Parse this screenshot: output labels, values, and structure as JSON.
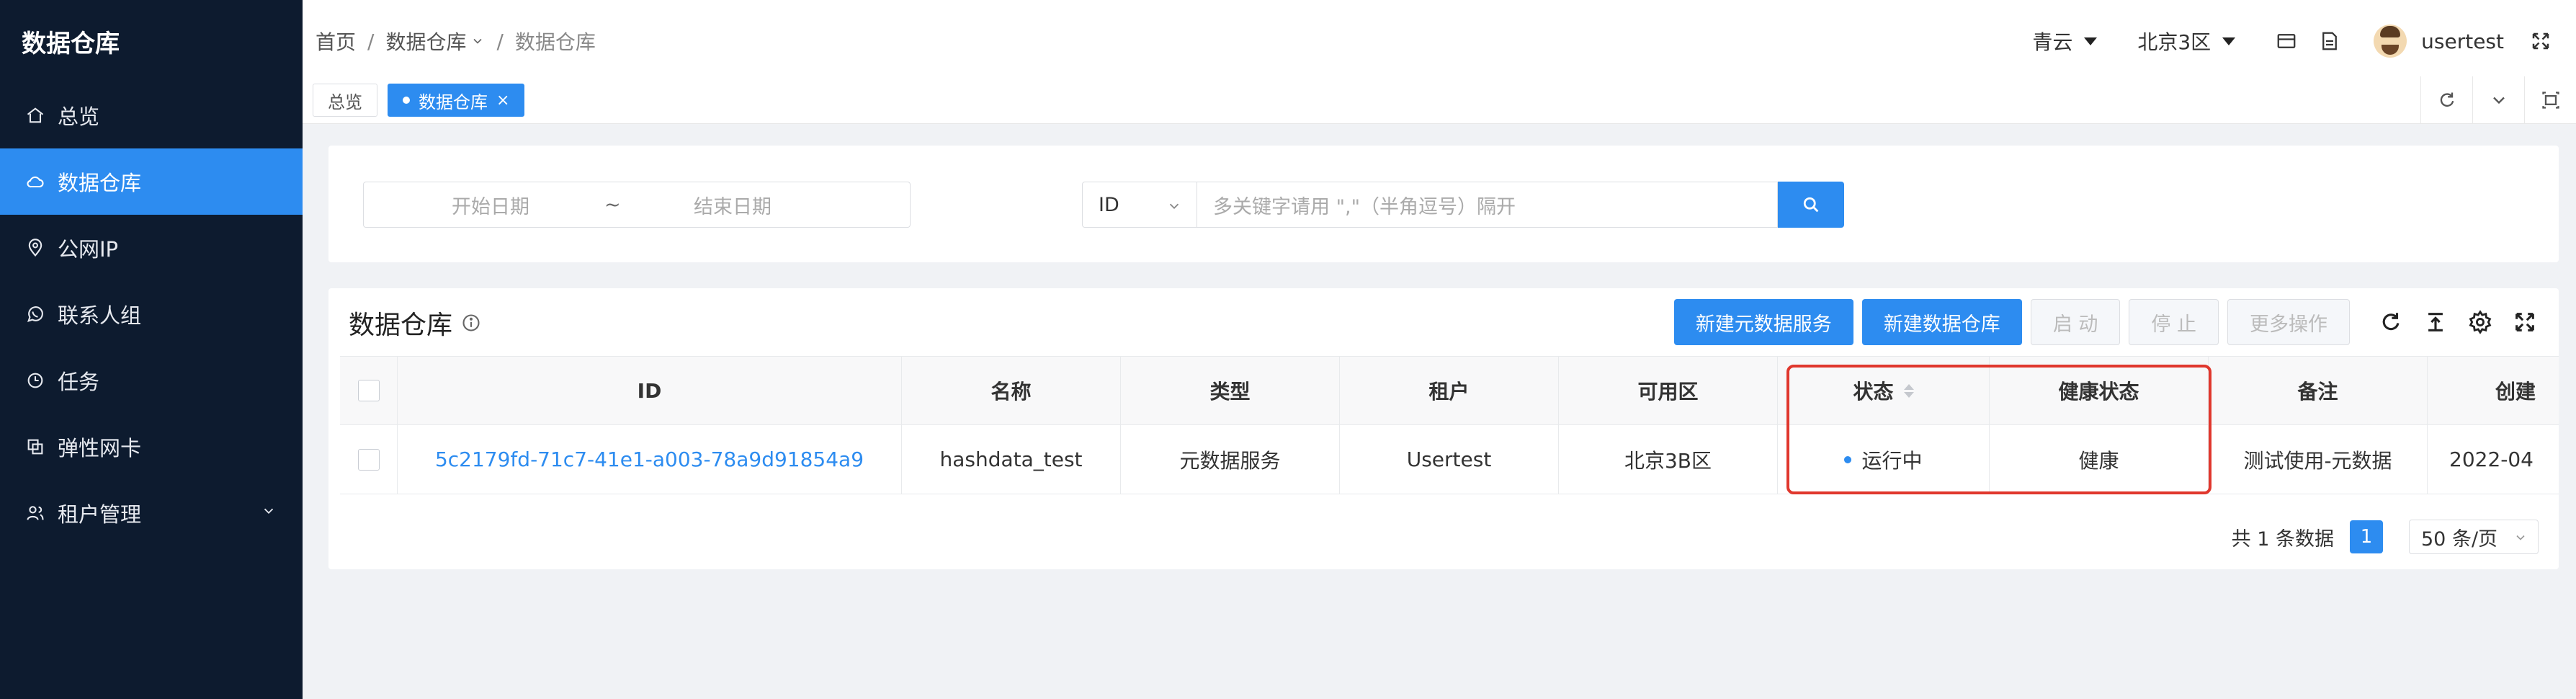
{
  "sidebar": {
    "brand": "数据仓库",
    "items": [
      {
        "label": "总览",
        "icon": "home-icon"
      },
      {
        "label": "数据仓库",
        "icon": "cloud-icon",
        "active": true
      },
      {
        "label": "公网IP",
        "icon": "location-icon"
      },
      {
        "label": "联系人组",
        "icon": "whatsapp-icon"
      },
      {
        "label": "任务",
        "icon": "clock-icon"
      },
      {
        "label": "弹性网卡",
        "icon": "copy-icon"
      },
      {
        "label": "租户管理",
        "icon": "users-icon",
        "expandable": true
      }
    ]
  },
  "header": {
    "breadcrumb": [
      "首页",
      "数据仓库",
      "数据仓库"
    ],
    "cloud": "青云",
    "zone": "北京3区",
    "username": "usertest"
  },
  "tabs": [
    {
      "label": "总览",
      "active": false
    },
    {
      "label": "数据仓库",
      "active": true
    }
  ],
  "filter": {
    "start_date": "开始日期",
    "tilde": "~",
    "end_date": "结束日期",
    "field": "ID",
    "keyword_placeholder": "多关键字请用 \",\"（半角逗号）隔开"
  },
  "main": {
    "title": "数据仓库",
    "buttons": {
      "new_meta": "新建元数据服务",
      "new_warehouse": "新建数据仓库",
      "start": "启 动",
      "stop": "停 止",
      "more": "更多操作"
    },
    "columns": [
      "ID",
      "名称",
      "类型",
      "租户",
      "可用区",
      "状态",
      "健康状态",
      "备注",
      "创建"
    ],
    "rows": [
      {
        "id": "5c2179fd-71c7-41e1-a003-78a9d91854a9",
        "name": "hashdata_test",
        "type": "元数据服务",
        "tenant": "Usertest",
        "zone": "北京3B区",
        "status": "运行中",
        "health": "健康",
        "remark": "测试使用-元数据",
        "created": "2022-04"
      }
    ],
    "pager": {
      "total": "共 1 条数据",
      "page": "1",
      "size": "50 条/页"
    }
  },
  "colors": {
    "sidebar_bg": "#0d1b2f",
    "accent": "#2d8cf0",
    "highlight": "#e0372d"
  }
}
